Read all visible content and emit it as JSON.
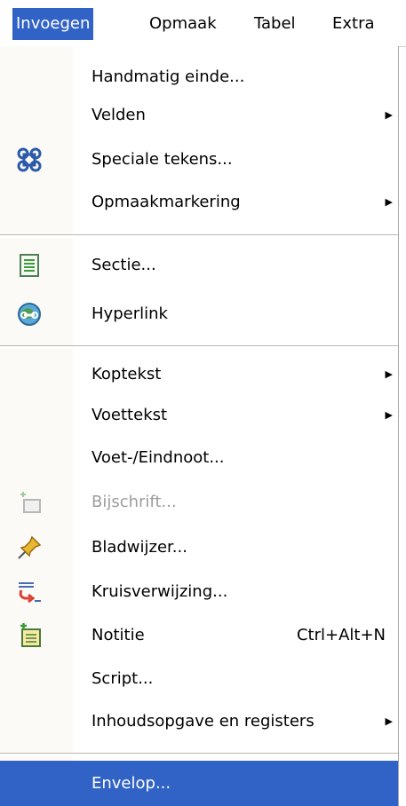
{
  "menubar": {
    "items": [
      {
        "label": "Invoegen"
      },
      {
        "label": "Opmaak"
      },
      {
        "label": "Tabel"
      },
      {
        "label": "Extra"
      }
    ]
  },
  "menu": {
    "items": [
      {
        "label": "Handmatig einde...",
        "icon": null,
        "submenu": false
      },
      {
        "label": "Velden",
        "icon": null,
        "submenu": true
      },
      {
        "label": "Speciale tekens...",
        "icon": "special-characters-icon",
        "submenu": false
      },
      {
        "label": "Opmaakmarkering",
        "icon": null,
        "submenu": true
      },
      {
        "label": "Sectie...",
        "icon": "section-icon",
        "submenu": false
      },
      {
        "label": "Hyperlink",
        "icon": "hyperlink-globe-icon",
        "submenu": false
      },
      {
        "label": "Koptekst",
        "icon": null,
        "submenu": true
      },
      {
        "label": "Voettekst",
        "icon": null,
        "submenu": true
      },
      {
        "label": "Voet-/Eindnoot...",
        "icon": null,
        "submenu": false
      },
      {
        "label": "Bijschrift...",
        "icon": "caption-icon",
        "submenu": false,
        "disabled": true
      },
      {
        "label": "Bladwijzer...",
        "icon": "bookmark-pin-icon",
        "submenu": false
      },
      {
        "label": "Kruisverwijzing...",
        "icon": "cross-reference-icon",
        "submenu": false
      },
      {
        "label": "Notitie",
        "icon": "note-icon",
        "submenu": false,
        "accelerator": "Ctrl+Alt+N"
      },
      {
        "label": "Script...",
        "icon": null,
        "submenu": false
      },
      {
        "label": "Inhoudsopgave en registers",
        "icon": null,
        "submenu": true
      },
      {
        "label": "Envelop...",
        "icon": null,
        "submenu": false,
        "selected": true
      }
    ]
  },
  "colors": {
    "highlight": "#3163c6",
    "disabled_text": "#9c9c9c",
    "separator": "#b9b7ad"
  }
}
